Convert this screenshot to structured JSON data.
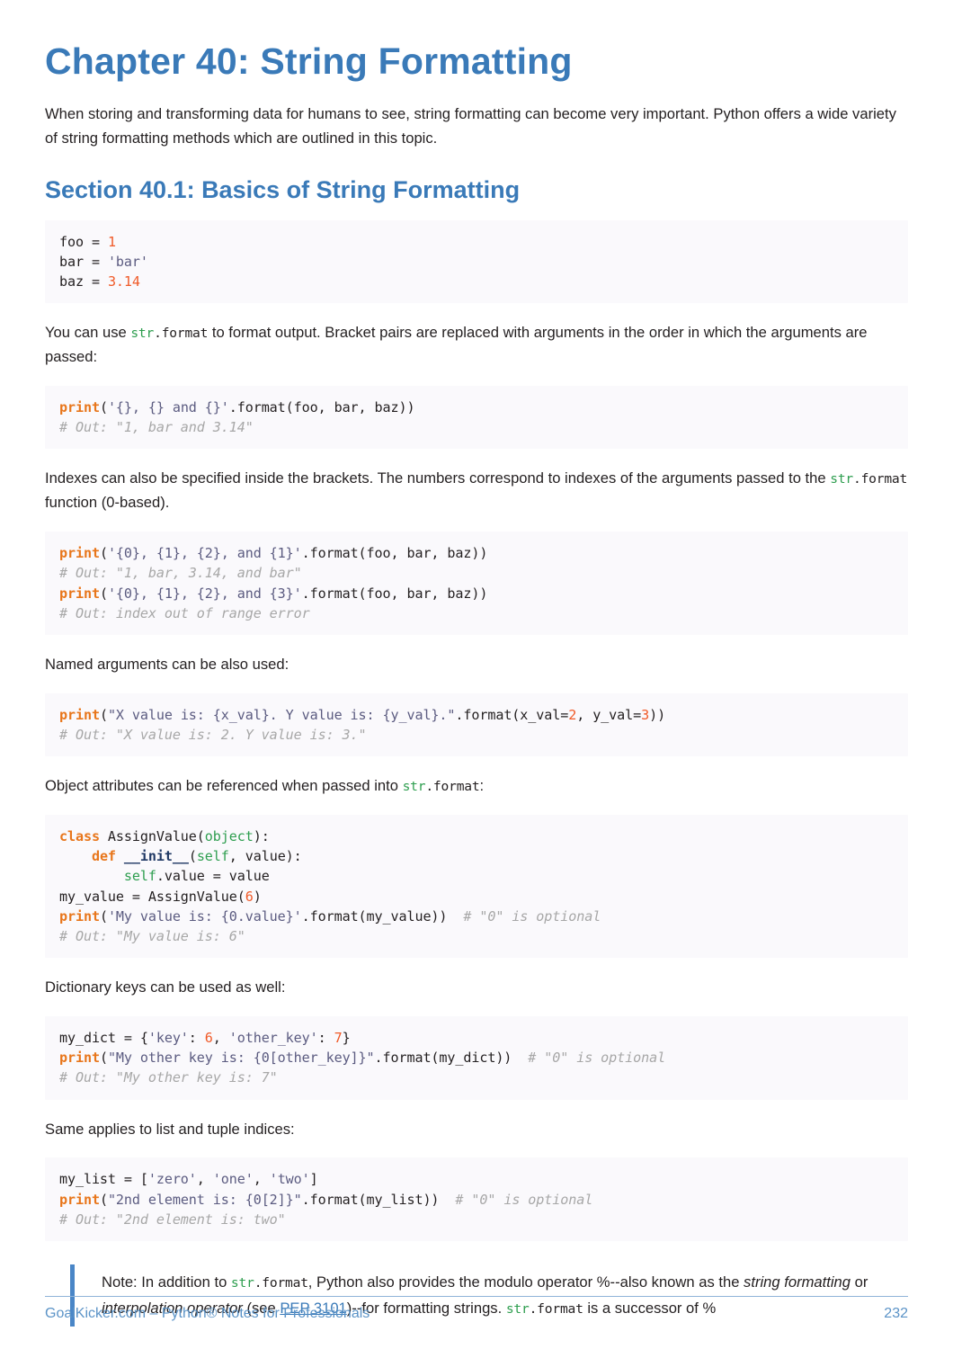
{
  "chapter": {
    "title": "Chapter 40: String Formatting",
    "intro": "When storing and transforming data for humans to see, string formatting can become very important. Python offers a wide variety of string formatting methods which are outlined in this topic."
  },
  "section": {
    "title": "Section 40.1: Basics of String Formatting"
  },
  "paragraphs": {
    "p1_a": "You can use ",
    "p1_code": "str.format",
    "p1_b": " to format output. Bracket pairs are replaced with arguments in the order in which the arguments are passed:",
    "p2_a": "Indexes can also be specified inside the brackets. The numbers correspond to indexes of the arguments passed to the ",
    "p2_code": "str.format",
    "p2_b": " function (0-based).",
    "p3": "Named arguments can be also used:",
    "p4_a": "Object attributes can be referenced when passed into ",
    "p4_code": "str.format",
    "p4_b": ":",
    "p5": "Dictionary keys can be used as well:",
    "p6": "Same applies to list and tuple indices:"
  },
  "code_blocks": {
    "vars": {
      "l1_name": "foo",
      "l1_eq": " = ",
      "l1_val": "1",
      "l2_name": "bar",
      "l2_eq": " = ",
      "l2_val": "'bar'",
      "l3_name": "baz",
      "l3_eq": " = ",
      "l3_val": "3.14"
    },
    "basic_format": {
      "fn": "print",
      "open": "(",
      "str": "'{}, {} and {}'",
      "rest": ".format(foo, bar, baz))",
      "comment": "# Out: \"1, bar and 3.14\""
    },
    "indexed": {
      "l1_fn": "print",
      "l1_open": "(",
      "l1_str": "'{0}, {1}, {2}, and {1}'",
      "l1_rest": ".format(foo, bar, baz))",
      "l2_comment": "# Out: \"1, bar, 3.14, and bar\"",
      "l3_fn": "print",
      "l3_open": "(",
      "l3_str": "'{0}, {1}, {2}, and {3}'",
      "l3_rest": ".format(foo, bar, baz))",
      "l4_comment": "# Out: index out of range error"
    },
    "named": {
      "fn": "print",
      "open": "(",
      "str": "\"X value is: {x_val}. Y value is: {y_val}.\"",
      "mid": ".format(x_val=",
      "num1": "2",
      "mid2": ", y_val=",
      "num2": "3",
      "close": "))",
      "comment": "# Out: \"X value is: 2. Y value is: 3.\""
    },
    "attributes": {
      "l1_kw": "class",
      "l1_name": " AssignValue(",
      "l1_obj": "object",
      "l1_end": "):",
      "l2_indent": "    ",
      "l2_kw": "def",
      "l2_dunder": " __init__",
      "l2_open": "(",
      "l2_self": "self",
      "l2_rest": ", value):",
      "l3_indent": "        ",
      "l3_self": "self",
      "l3_rest": ".value = value",
      "l4_text": "my_value = AssignValue(",
      "l4_num": "6",
      "l4_end": ")",
      "l5_fn": "print",
      "l5_open": "(",
      "l5_str": "'My value is: {0.value}'",
      "l5_rest": ".format(my_value))",
      "l5_comment": "  # \"0\" is optional",
      "l6_comment": "# Out: \"My value is: 6\""
    },
    "dict_keys": {
      "l1_a": "my_dict = {",
      "l1_k1": "'key'",
      "l1_b": ": ",
      "l1_n1": "6",
      "l1_c": ", ",
      "l1_k2": "'other_key'",
      "l1_d": ": ",
      "l1_n2": "7",
      "l1_e": "}",
      "l2_fn": "print",
      "l2_open": "(",
      "l2_str": "\"My other key is: {0[other_key]}\"",
      "l2_rest": ".format(my_dict))",
      "l2_comment": "  # \"0\" is optional",
      "l3_comment": "# Out: \"My other key is: 7\""
    },
    "list_indices": {
      "l1_a": "my_list = [",
      "l1_s1": "'zero'",
      "l1_b": ", ",
      "l1_s2": "'one'",
      "l1_c": ", ",
      "l1_s3": "'two'",
      "l1_d": "]",
      "l2_fn": "print",
      "l2_open": "(",
      "l2_str": "\"2nd element is: {0[2]}\"",
      "l2_rest": ".format(my_list))",
      "l2_comment": "  # \"0\" is optional",
      "l3_comment": "# Out: \"2nd element is: two\""
    }
  },
  "note": {
    "t1": "Note: In addition to ",
    "code1": "str.format",
    "t2": ", Python also provides the modulo operator %--also known as the ",
    "em1": "string formatting",
    "t3": " or ",
    "em2": "interpolation operator",
    "t4": " (see ",
    "link": "PEP 3101",
    "t5": ")--for formatting strings. ",
    "code2": "str.format",
    "t6": " is a successor of %"
  },
  "footer": {
    "text": "GoalKicker.com – Python® Notes for Professionals",
    "page": "232"
  },
  "colors": {
    "heading_blue": "#3a7ab8",
    "keyword_orange": "#e8761b",
    "number_orange": "#f05a28",
    "string_slate": "#5b5b80",
    "comment_gray": "#a7a7a7",
    "builtin_green": "#2e9e4f",
    "code_bg": "#faf9fc",
    "note_border": "#4a86c7",
    "footer_blue": "#5b93c7"
  }
}
